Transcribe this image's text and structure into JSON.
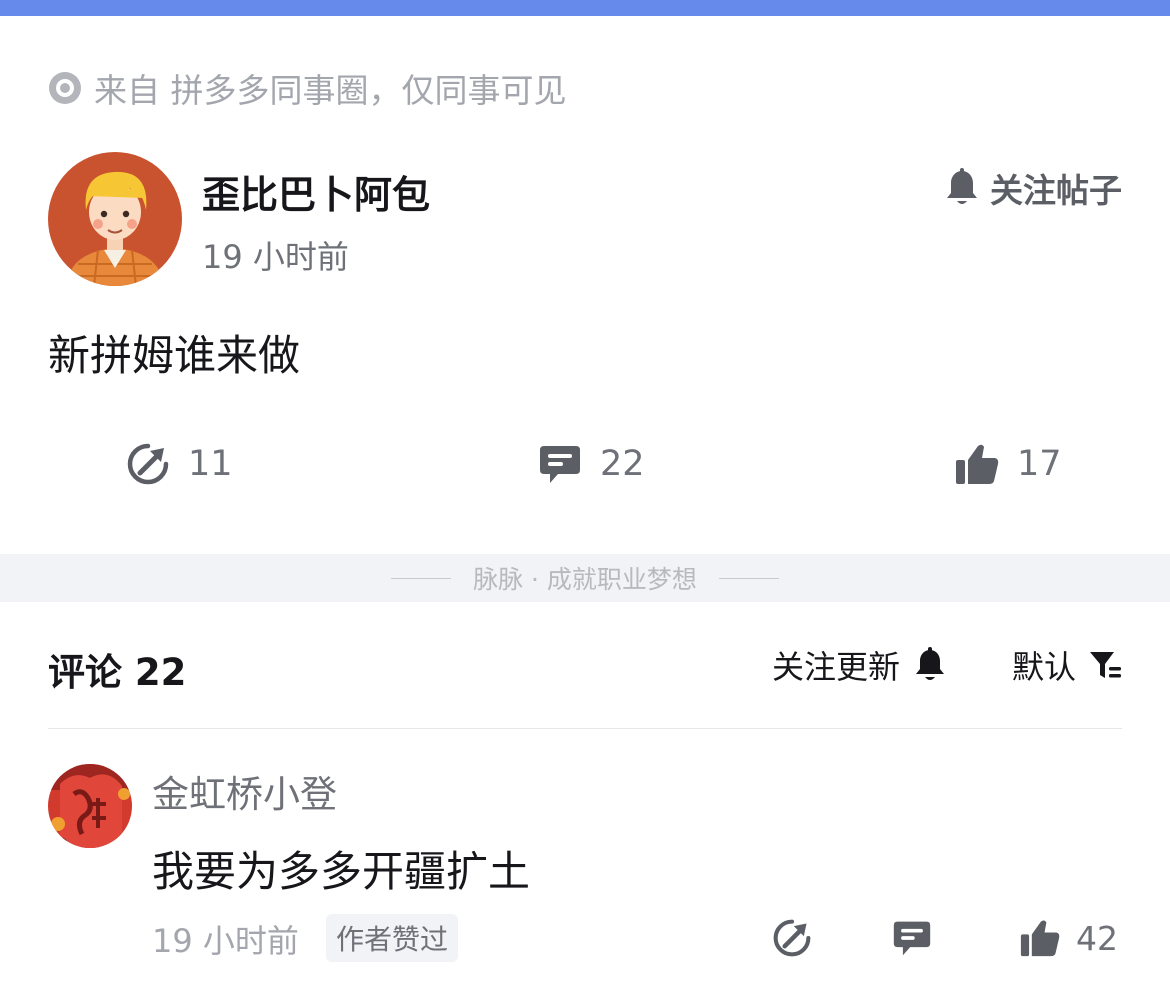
{
  "source": {
    "icon": "target-icon",
    "text": "来自 拼多多同事圈，仅同事可见"
  },
  "post": {
    "author_name": "歪比巴卜阿包",
    "time": "19 小时前",
    "follow_label": "关注帖子",
    "content": "新拼姆谁来做",
    "share_count": "11",
    "comment_count": "22",
    "like_count": "17"
  },
  "divider": {
    "text": "脉脉 · 成就职业梦想"
  },
  "comments_section": {
    "title": "评论 22",
    "follow_updates_label": "关注更新",
    "sort_label": "默认"
  },
  "comments": [
    {
      "name": "金虹桥小登",
      "text": "我要为多多开疆扩土",
      "time": "19 小时前",
      "badge": "作者赞过",
      "like_count": "42"
    }
  ],
  "colors": {
    "top_bar": "#6689ec",
    "icon_gray": "#5c5e66",
    "muted_text": "#a3a6ad"
  }
}
